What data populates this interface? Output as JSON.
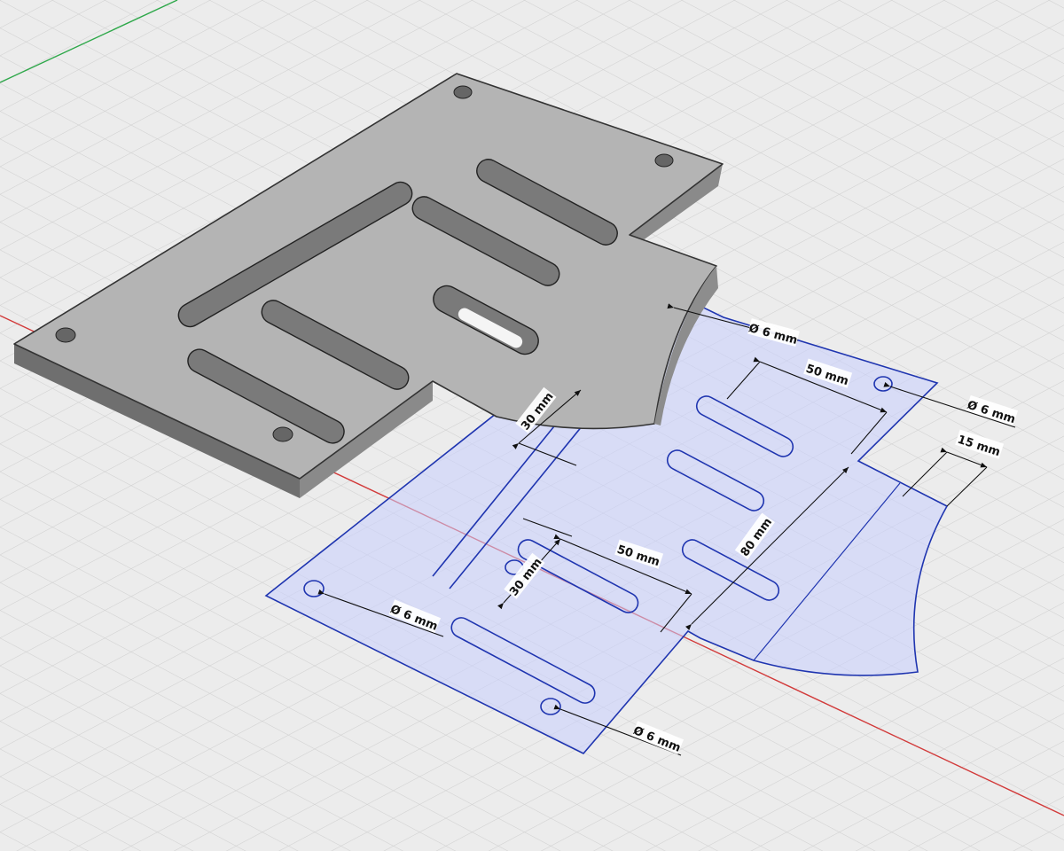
{
  "viewport": {
    "background": "#ececec",
    "grid_color": "#c8c8c8",
    "axis_x_color": "#d23a3a",
    "axis_y_color": "#2ea84a",
    "solid_top_color": "#b4b4b4",
    "solid_side_color": "#7d7d7d",
    "sketch_fill": "#c9d0ff",
    "sketch_stroke": "#1f35b0"
  },
  "dimensions": {
    "hole_top": "Ø 6 mm",
    "slot_len_top": "50 mm",
    "hole_right": "Ø 6 mm",
    "edge_offset": "15 mm",
    "slot_gap_top": "30 mm",
    "slot_gap_mid": "30 mm",
    "slot_len_mid": "50 mm",
    "height_80": "80 mm",
    "hole_left": "Ø 6 mm",
    "hole_bottom": "Ø 6 mm"
  }
}
